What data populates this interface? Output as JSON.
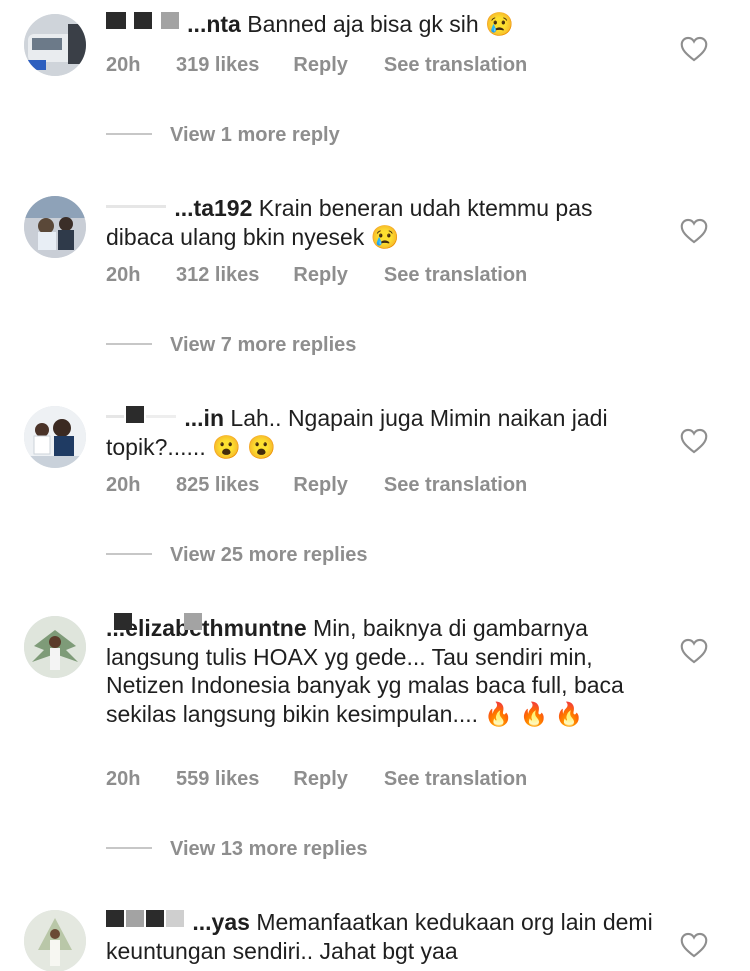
{
  "comments": [
    {
      "username_visible": "...nta",
      "text": "Banned aja bisa gk sih 😢",
      "age": "20h",
      "likes": "319 likes",
      "reply": "Reply",
      "translate": "See translation",
      "more_replies": "View 1 more reply"
    },
    {
      "username_visible": "...ta192",
      "text": "Krain beneran udah ktemmu pas dibaca ulang bkin nyesek 😢",
      "age": "20h",
      "likes": "312 likes",
      "reply": "Reply",
      "translate": "See translation",
      "more_replies": "View 7 more replies"
    },
    {
      "username_visible": "...in",
      "text": "Lah.. Ngapain juga Mimin naikan jadi topik?...... 😮 😮",
      "age": "20h",
      "likes": "825 likes",
      "reply": "Reply",
      "translate": "See translation",
      "more_replies": "View 25 more replies"
    },
    {
      "username_visible": "...elizabethmuntne",
      "text": "Min, baiknya di gambarnya langsung tulis HOAX yg gede... Tau sendiri min, Netizen Indonesia banyak yg malas baca full, baca sekilas langsung bikin kesimpulan.... 🔥 🔥 🔥",
      "age": "20h",
      "likes": "559 likes",
      "reply": "Reply",
      "translate": "See translation",
      "more_replies": "View 13 more replies"
    },
    {
      "username_visible": "...yas",
      "text": "Memanfaatkan kedukaan org lain demi keuntungan sendiri.. Jahat bgt yaa"
    }
  ],
  "icons": {
    "like": "heart-outline-icon"
  },
  "colors": {
    "meta_text": "#8e8e8e",
    "body_text": "#1f1f1f",
    "background": "#ffffff"
  }
}
